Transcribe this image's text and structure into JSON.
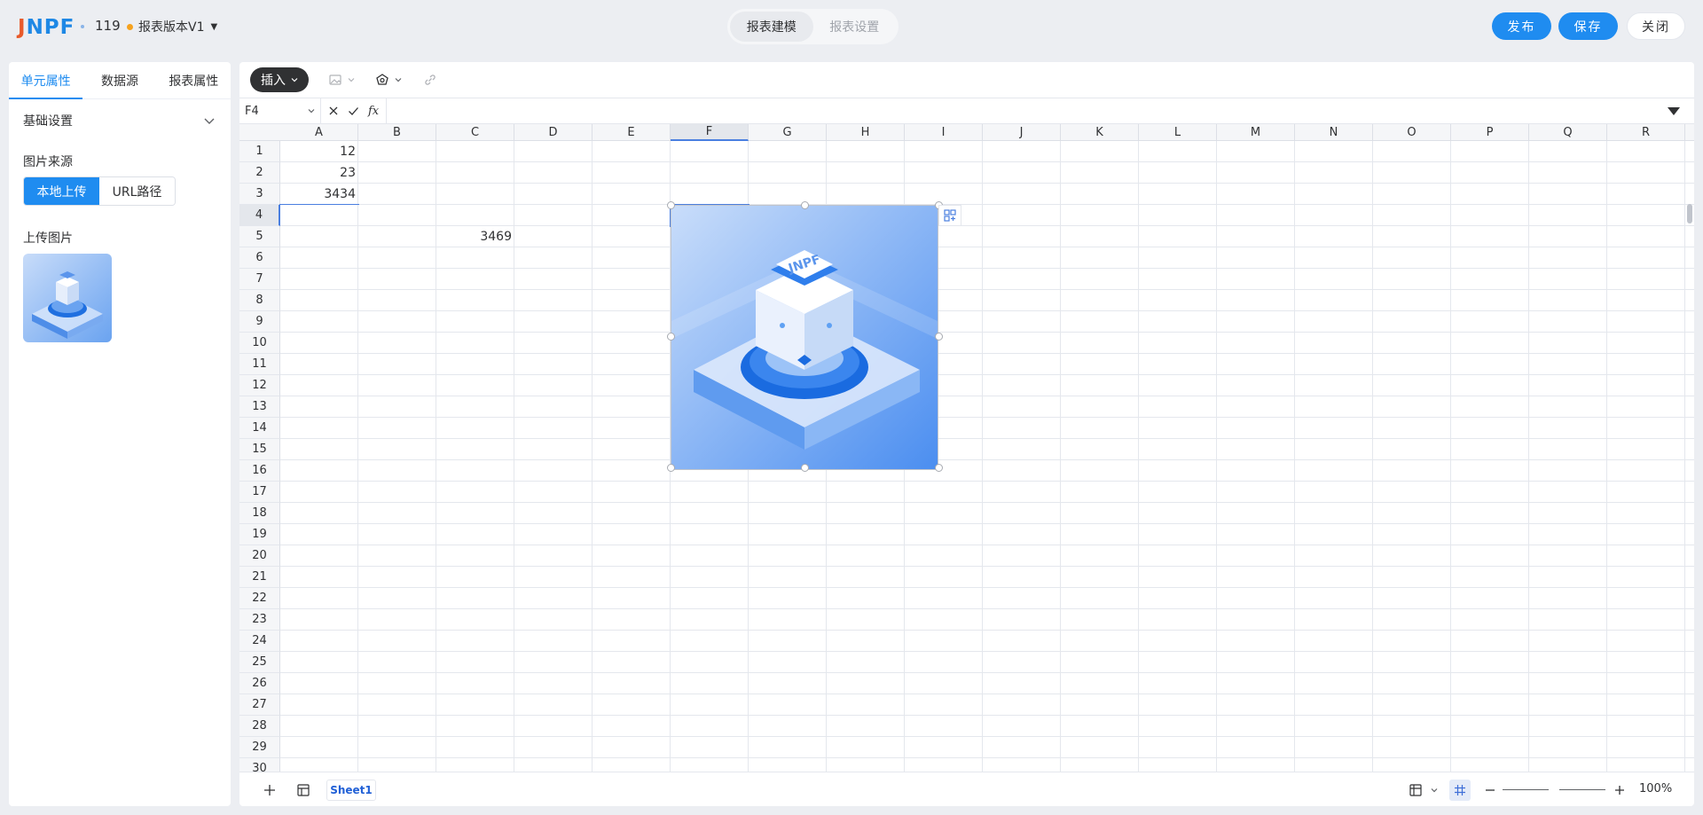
{
  "header": {
    "logo_part1": "J",
    "logo_part2": "NPF",
    "doc_id": "119",
    "version_label": "报表版本V1",
    "modes": [
      "报表建模",
      "报表设置"
    ],
    "publish_label": "发布",
    "save_label": "保存",
    "close_label": "关闭"
  },
  "left_panel": {
    "tabs": [
      "单元属性",
      "数据源",
      "报表属性"
    ],
    "section_title": "基础设置",
    "image_source_label": "图片来源",
    "source_options": [
      "本地上传",
      "URL路径"
    ],
    "upload_label": "上传图片"
  },
  "toolbar": {
    "insert_label": "插入"
  },
  "formula_bar": {
    "cell_ref": "F4",
    "fx_label": "fx"
  },
  "grid": {
    "columns": [
      "A",
      "B",
      "C",
      "D",
      "E",
      "F",
      "G",
      "H",
      "I",
      "J",
      "K",
      "L",
      "M",
      "N",
      "O",
      "P",
      "Q",
      "R"
    ],
    "rows": [
      "1",
      "2",
      "3",
      "4",
      "5",
      "6",
      "7",
      "8",
      "9",
      "10",
      "11",
      "12",
      "13",
      "14",
      "15",
      "16",
      "17",
      "18",
      "19",
      "20",
      "21",
      "22",
      "23",
      "24",
      "25",
      "26",
      "27",
      "28",
      "29",
      "30"
    ],
    "cells": {
      "A1": "12",
      "A2": "23",
      "A3": "3434",
      "C5": "3469"
    },
    "image_text": "JNPF"
  },
  "bottom": {
    "sheet_name": "Sheet1",
    "zoom": "100%"
  },
  "colors": {
    "primary": "#1f8cf0",
    "version_dot": "#f6a21e",
    "selection": "#4a7fe0"
  }
}
